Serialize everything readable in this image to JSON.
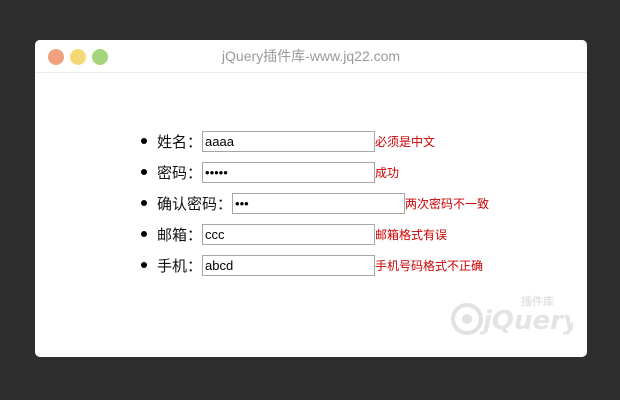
{
  "window": {
    "title": "jQuery插件库-www.jq22.com",
    "traffic_lights": {
      "close_color": "#f2a07e",
      "minimize_color": "#f5d876",
      "maximize_color": "#a4d57a"
    }
  },
  "form": {
    "rows": [
      {
        "label": "姓名：",
        "value": "aaaa",
        "input_type": "text",
        "error": "必须是中文"
      },
      {
        "label": "密码：",
        "value": "aaaaa",
        "input_type": "password",
        "error": "成功"
      },
      {
        "label": "确认密码：",
        "value": "aaa",
        "input_type": "password",
        "error": "两次密码不一致"
      },
      {
        "label": "邮箱：",
        "value": "ccc",
        "input_type": "text",
        "error": "邮箱格式有误"
      },
      {
        "label": "手机：",
        "value": "abcd",
        "input_type": "text",
        "error": "手机号码格式不正确"
      }
    ],
    "error_color": "#cc0000"
  },
  "watermark": {
    "text": "jQuery",
    "subtext": "插件库"
  }
}
